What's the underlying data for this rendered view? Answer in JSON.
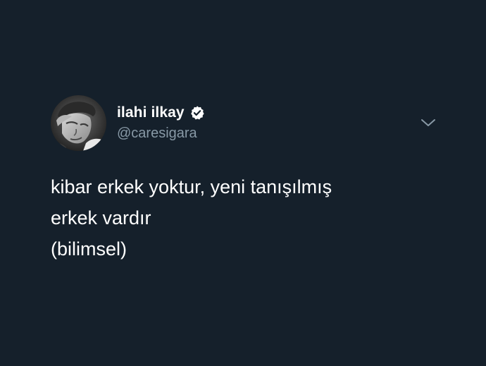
{
  "author": {
    "display_name": "ilahi ilkay",
    "handle": "@caresigara",
    "verified": true,
    "avatar_icon": "profile-photo"
  },
  "tweet": {
    "lines": [
      "kibar erkek yoktur, yeni tanışılmış",
      "erkek vardır",
      "(bilimsel)"
    ]
  },
  "menu": {
    "icon": "chevron-down-icon"
  },
  "colors": {
    "background": "#15202b",
    "text": "#ffffff",
    "secondary_text": "#8899a6",
    "chevron": "#8899a6",
    "verified_badge": "#ffffff"
  }
}
